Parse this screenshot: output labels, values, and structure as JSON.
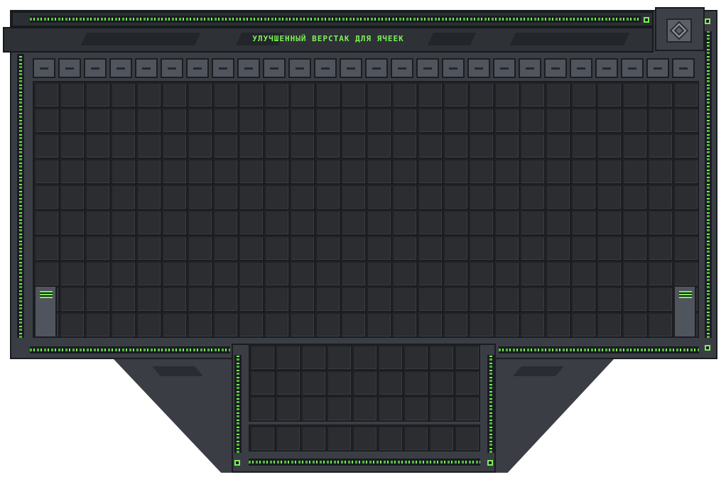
{
  "window": {
    "title": "УЛУЧШЕННЫЙ ВЕРСТАК ДЛЯ ЯЧЕЕК",
    "title_color": "#7df05a",
    "corner_icon": "diamond-emblem-icon"
  },
  "tabs": {
    "count": 26,
    "icon": "minus-icon"
  },
  "main_grid": {
    "columns": 26,
    "rows": 10
  },
  "side_tabs": {
    "icon": "menu-lines-icon"
  },
  "crafting_grid": {
    "columns": 9,
    "rows": 3
  },
  "output_row": {
    "columns": 9,
    "rows": 1
  },
  "colors": {
    "accent": "#7df05a",
    "panel": "#3a3d44",
    "slot": "#2b2d31"
  }
}
